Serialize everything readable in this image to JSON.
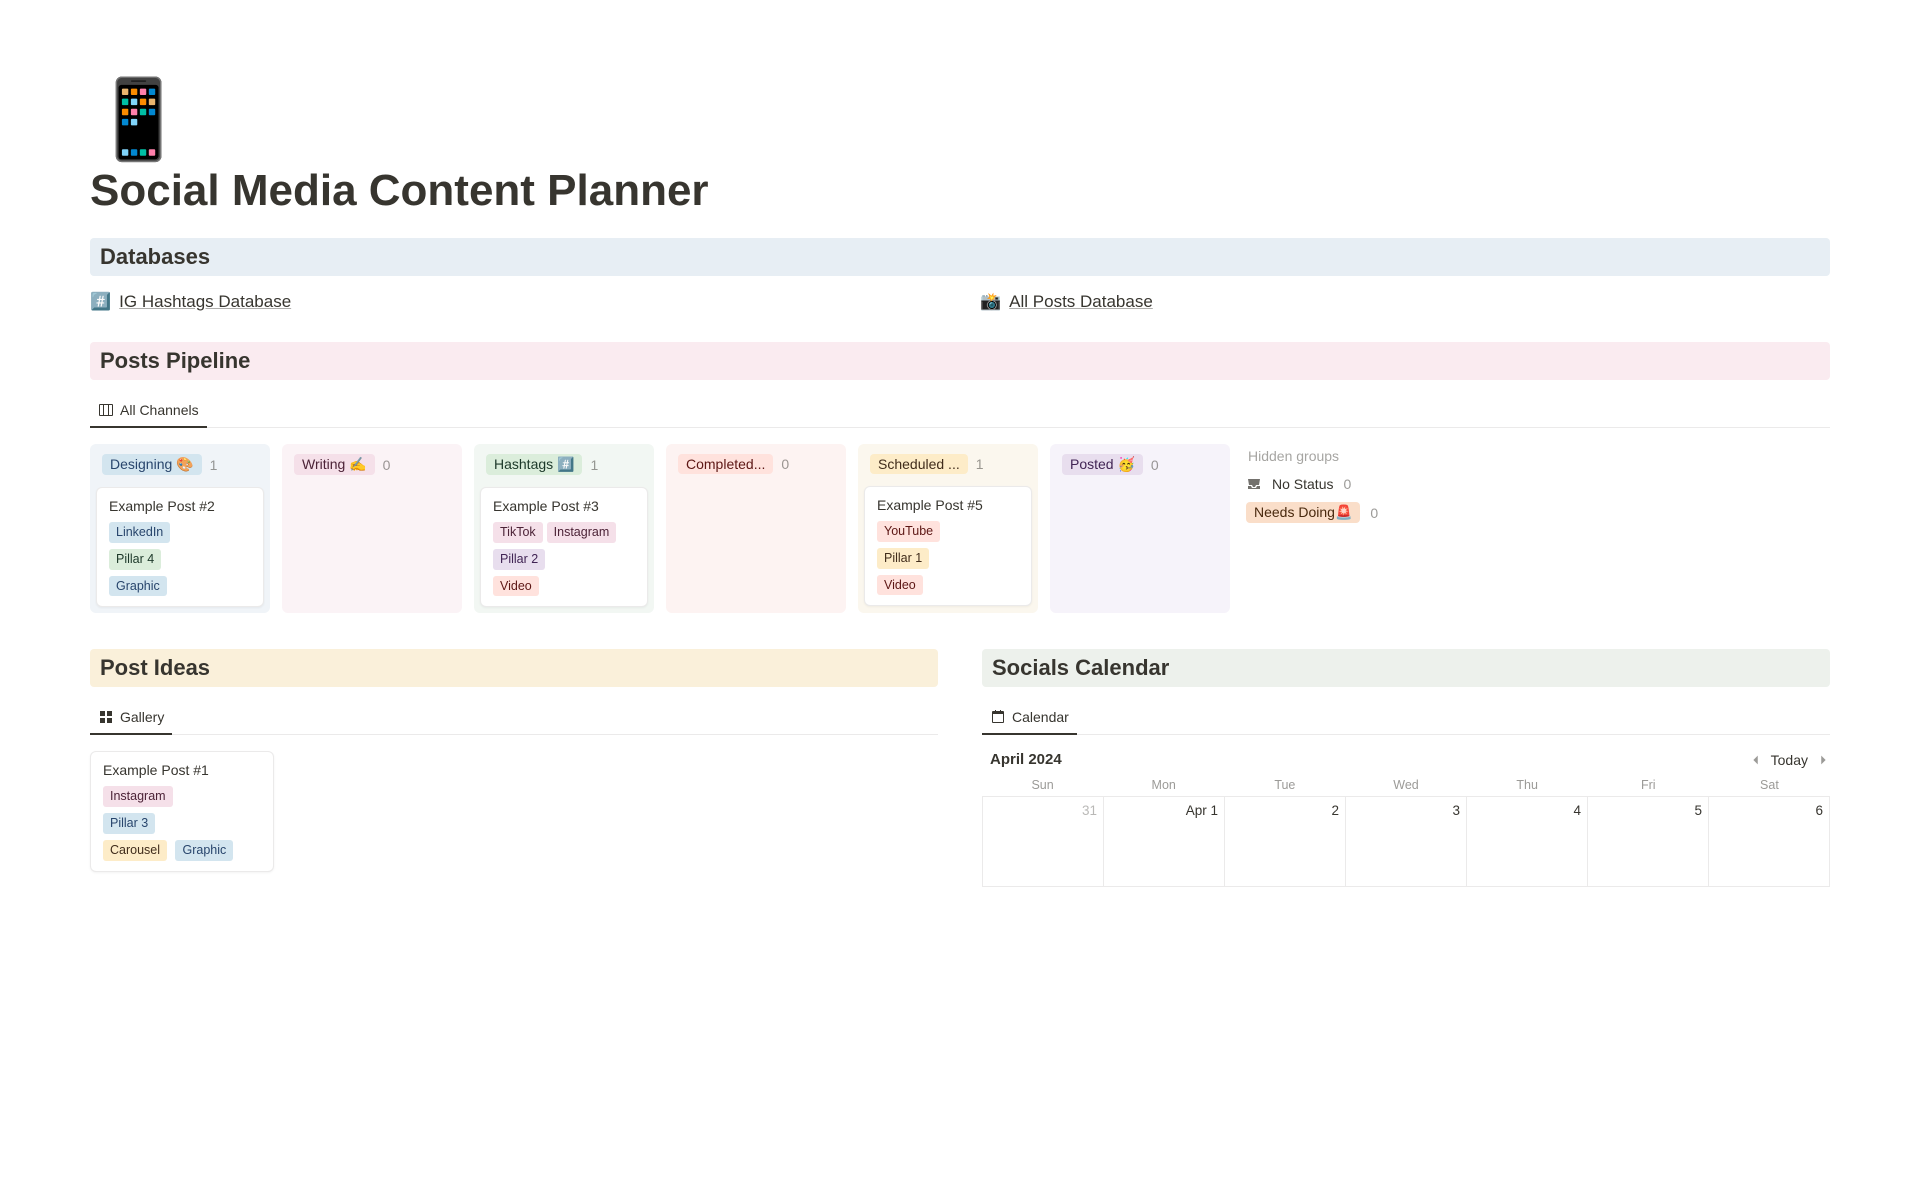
{
  "page": {
    "icon": "📱",
    "title": "Social Media Content Planner"
  },
  "sections": {
    "databases": {
      "heading": "Databases",
      "items": [
        {
          "icon": "#️⃣",
          "label": "IG Hashtags Database"
        },
        {
          "icon": "📸",
          "label": "All Posts Database"
        }
      ]
    },
    "pipeline": {
      "heading": "Posts Pipeline",
      "tab": "All Channels",
      "hidden_label": "Hidden groups",
      "hidden": {
        "no_status": {
          "label": "No Status",
          "count": "0"
        },
        "needs_doing": {
          "label": "Needs Doing🚨",
          "count": "0"
        }
      },
      "columns": [
        {
          "status": "Designing 🎨",
          "status_class": "c-blue",
          "bg": "col-bg-blue",
          "count": "1",
          "cards": [
            {
              "title": "Example Post #2",
              "tags": [
                {
                  "text": "LinkedIn",
                  "cls": "c-blue"
                },
                {
                  "text": "Pillar 4",
                  "cls": "c-green"
                },
                {
                  "text": "Graphic",
                  "cls": "c-blue"
                }
              ]
            }
          ]
        },
        {
          "status": "Writing ✍️",
          "status_class": "c-pink",
          "bg": "col-bg-pink",
          "count": "0",
          "cards": []
        },
        {
          "status": "Hashtags #️⃣",
          "status_class": "c-green",
          "bg": "col-bg-green",
          "count": "1",
          "cards": [
            {
              "title": "Example Post #3",
              "tags": [
                {
                  "text": "TikTok",
                  "cls": "c-pink"
                },
                {
                  "text": "Instagram",
                  "cls": "c-pink"
                },
                {
                  "text": "Pillar 2",
                  "cls": "c-purple"
                },
                {
                  "text": "Video",
                  "cls": "c-red"
                }
              ]
            }
          ]
        },
        {
          "status": "Completed...",
          "status_class": "c-red",
          "bg": "col-bg-red",
          "count": "0",
          "cards": []
        },
        {
          "status": "Scheduled ...",
          "status_class": "c-yellow",
          "bg": "col-bg-yellow",
          "count": "1",
          "cards": [
            {
              "title": "Example Post #5",
              "tags": [
                {
                  "text": "YouTube",
                  "cls": "c-red"
                },
                {
                  "text": "Pillar 1",
                  "cls": "c-yellow"
                },
                {
                  "text": "Video",
                  "cls": "c-red"
                }
              ]
            }
          ]
        },
        {
          "status": "Posted 🥳",
          "status_class": "c-purple",
          "bg": "col-bg-purple",
          "count": "0",
          "cards": []
        }
      ]
    },
    "ideas": {
      "heading": "Post Ideas",
      "tab": "Gallery",
      "card": {
        "title": "Example Post #1",
        "tags": [
          {
            "text": "Instagram",
            "cls": "c-pink"
          },
          {
            "text": "Pillar 3",
            "cls": "c-blue"
          },
          {
            "text": "Carousel",
            "cls": "c-yellow"
          },
          {
            "text": "Graphic",
            "cls": "c-blue"
          }
        ]
      }
    },
    "calendar": {
      "heading": "Socials Calendar",
      "tab": "Calendar",
      "month": "April 2024",
      "today_label": "Today",
      "weekdays": [
        "Sun",
        "Mon",
        "Tue",
        "Wed",
        "Thu",
        "Fri",
        "Sat"
      ],
      "cells": [
        {
          "label": "31",
          "faded": true
        },
        {
          "label": "Apr 1"
        },
        {
          "label": "2"
        },
        {
          "label": "3"
        },
        {
          "label": "4"
        },
        {
          "label": "5"
        },
        {
          "label": "6"
        }
      ]
    }
  }
}
